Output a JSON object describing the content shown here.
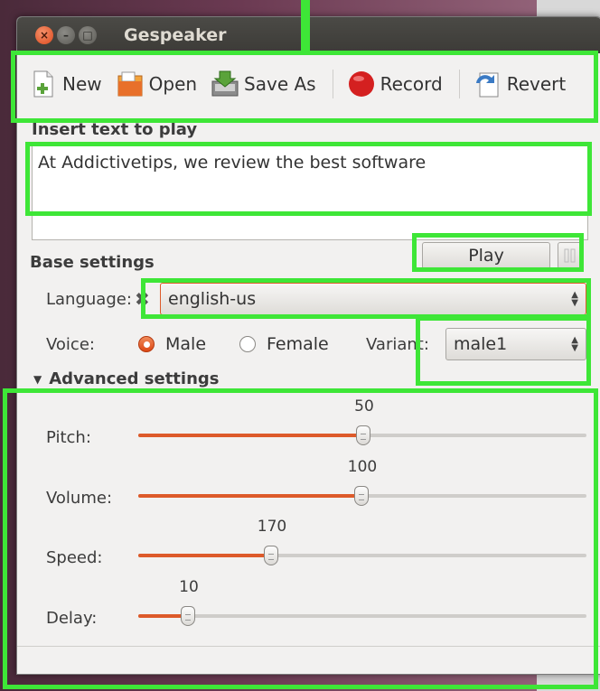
{
  "window": {
    "title": "Gespeaker"
  },
  "toolbar": {
    "new_label": "New",
    "open_label": "Open",
    "saveas_label": "Save As",
    "record_label": "Record",
    "revert_label": "Revert"
  },
  "text_section": {
    "label": "Insert text to play",
    "value": "At Addictivetips, we review the best software"
  },
  "play": {
    "label": "Play"
  },
  "base_settings": {
    "label": "Base settings",
    "language_label": "Language:",
    "language_value": "english-us",
    "voice_label": "Voice:",
    "voice_male": "Male",
    "voice_female": "Female",
    "voice_selected": "Male",
    "variant_label": "Variant:",
    "variant_value": "male1"
  },
  "advanced": {
    "label": "Advanced settings",
    "pitch": {
      "label": "Pitch:",
      "value": "50"
    },
    "volume": {
      "label": "Volume:",
      "value": "100"
    },
    "speed": {
      "label": "Speed:",
      "value": "170"
    },
    "delay": {
      "label": "Delay:",
      "value": "10"
    }
  },
  "colors": {
    "accent": "#dd4814",
    "annotation": "#3ee637"
  }
}
